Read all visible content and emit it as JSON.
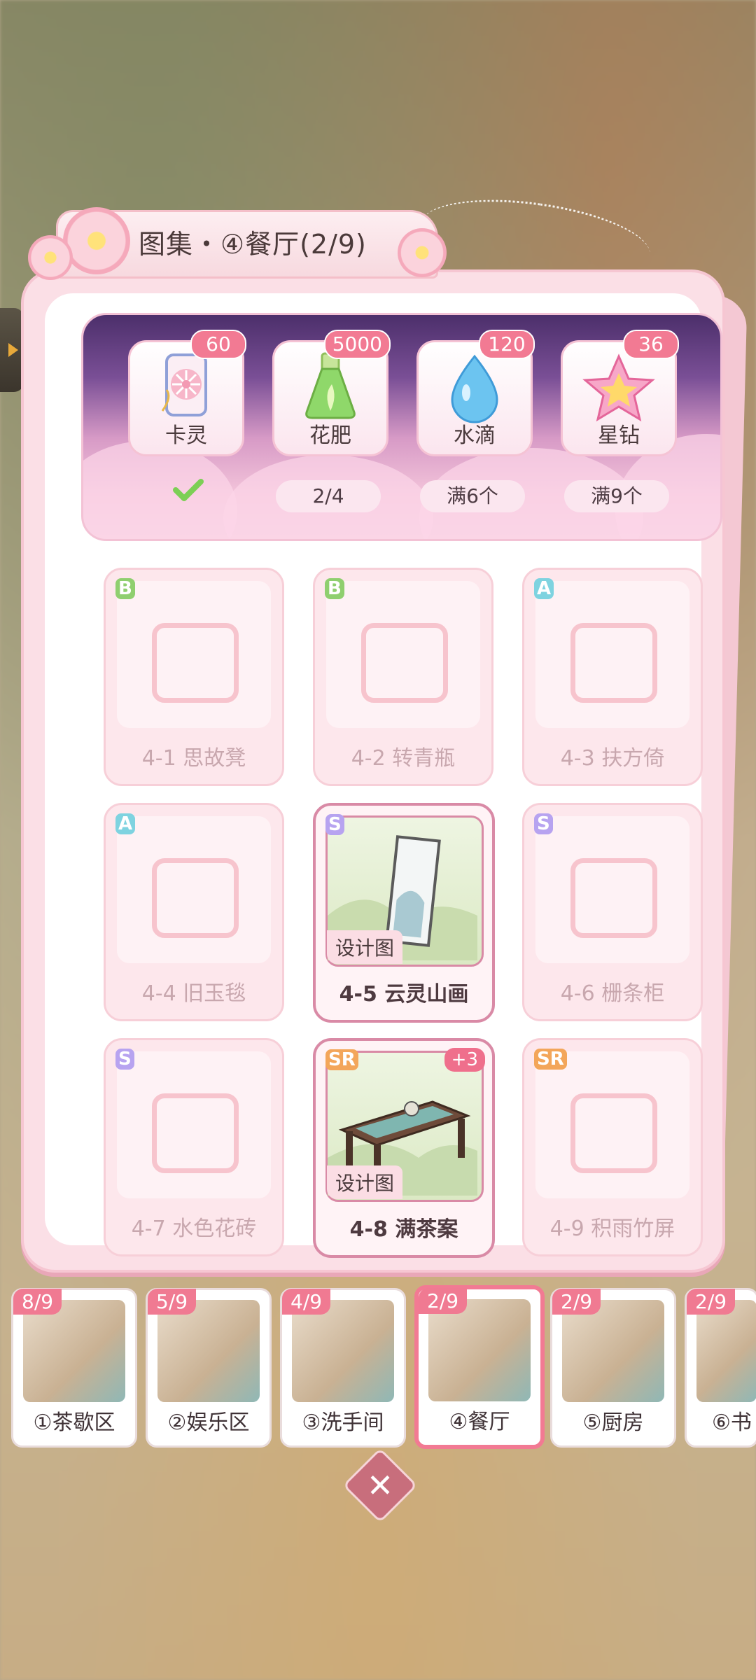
{
  "title": "图集・④餐厅(2/9)",
  "rewards": [
    {
      "label": "卡灵",
      "badge": "60",
      "status": ""
    },
    {
      "label": "花肥",
      "badge": "5000",
      "status": "2/4"
    },
    {
      "label": "水滴",
      "badge": "120",
      "status": "满6个"
    },
    {
      "label": "星钻",
      "badge": "36",
      "status": "满9个"
    }
  ],
  "items": [
    {
      "rank": "B",
      "name": "4-1 思故凳"
    },
    {
      "rank": "B",
      "name": "4-2 转青瓶"
    },
    {
      "rank": "A",
      "name": "4-3 扶方倚"
    },
    {
      "rank": "A",
      "name": "4-4 旧玉毯"
    },
    {
      "rank": "S",
      "name": "4-5 云灵山画",
      "tag": "设计图"
    },
    {
      "rank": "S",
      "name": "4-6 栅条柜"
    },
    {
      "rank": "S",
      "name": "4-7 水色花砖"
    },
    {
      "rank": "SR",
      "name": "4-8 满茶案",
      "tag": "设计图",
      "plus": "+3"
    },
    {
      "rank": "SR",
      "name": "4-9 积雨竹屏"
    }
  ],
  "tabs": [
    {
      "count": "8/9",
      "label": "①茶歇区"
    },
    {
      "count": "5/9",
      "label": "②娱乐区"
    },
    {
      "count": "4/9",
      "label": "③洗手间"
    },
    {
      "count": "2/9",
      "label": "④餐厅"
    },
    {
      "count": "2/9",
      "label": "⑤厨房"
    },
    {
      "count": "2/9",
      "label": "⑥书"
    }
  ],
  "close": "✕",
  "colors": {
    "accent": "#f27a93",
    "rank_B": "#8fcf6f",
    "rank_A": "#7ed3e0",
    "rank_S": "#b7a3f0",
    "rank_SR": "#f3a65a"
  }
}
